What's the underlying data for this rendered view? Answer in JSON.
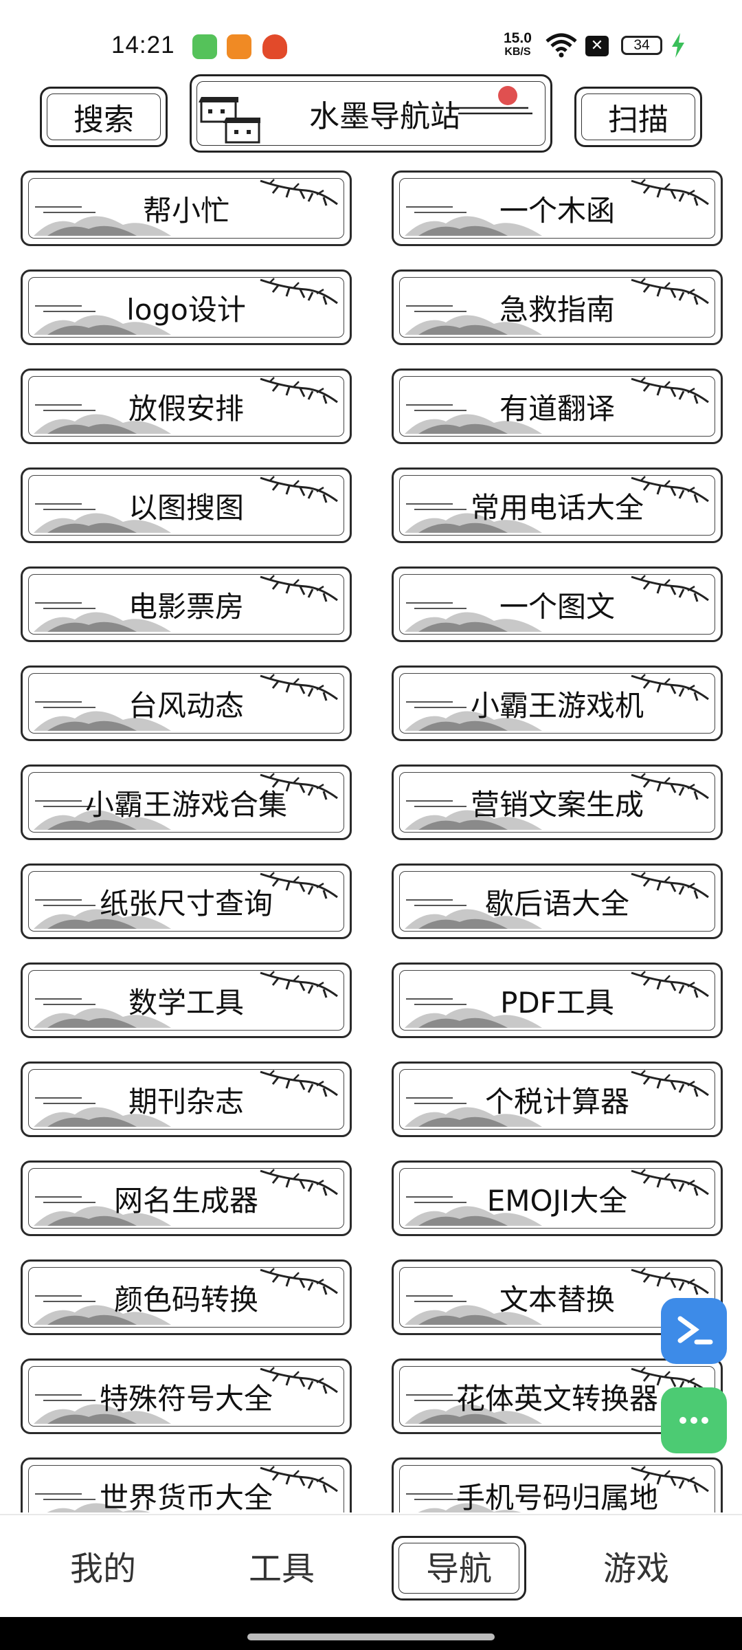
{
  "status_bar": {
    "time": "14:21",
    "net_speed_value": "15.0",
    "net_speed_unit": "KB/S",
    "battery": "34",
    "icons": [
      "wechat-icon",
      "camera-app-icon",
      "bag-app-icon",
      "wifi-icon",
      "x-icon",
      "battery-icon",
      "charging-bolt-icon"
    ]
  },
  "header": {
    "search_label": "搜索",
    "title": "水墨导航站",
    "scan_label": "扫描"
  },
  "tools": [
    "帮小忙",
    "一个木函",
    "logo设计",
    "急救指南",
    "放假安排",
    "有道翻译",
    "以图搜图",
    "常用电话大全",
    "电影票房",
    "一个图文",
    "台风动态",
    "小霸王游戏机",
    "小霸王游戏合集",
    "营销文案生成",
    "纸张尺寸查询",
    "歇后语大全",
    "数学工具",
    "PDF工具",
    "期刊杂志",
    "个税计算器",
    "网名生成器",
    "EMOJI大全",
    "颜色码转换",
    "文本替换",
    "特殊符号大全",
    "花体英文转换器",
    "世界货币大全",
    "手机号码归属地"
  ],
  "bottom_nav": {
    "items": [
      "我的",
      "工具",
      "导航",
      "游戏"
    ],
    "active": "导航"
  },
  "colors": {
    "ink": "#222222",
    "fab_blue": "#3d8be8",
    "fab_green": "#4ccb73",
    "sun_red": "#e05050"
  }
}
